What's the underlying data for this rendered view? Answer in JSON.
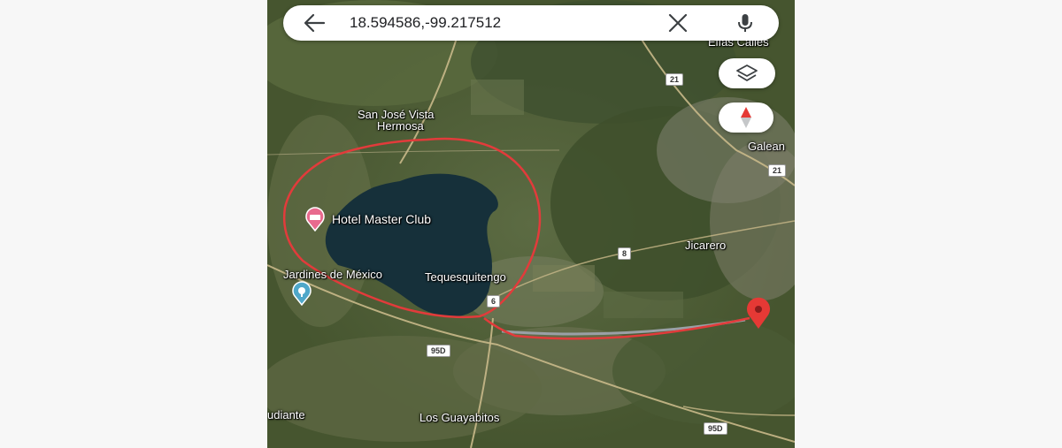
{
  "search": {
    "query": "18.594586,-99.217512",
    "back_icon": "arrow-left-icon",
    "clear_icon": "close-icon",
    "voice_icon": "microphone-icon"
  },
  "controls": {
    "layers_icon": "layers-icon",
    "compass_icon": "compass-icon"
  },
  "places": {
    "san_jose_line1": "San José Vista",
    "san_jose_line2": "Hermosa",
    "elias_calles": "Elías Calles",
    "galeana": "Galean",
    "hotel": "Hotel Master Club",
    "jardines": "Jardines de México",
    "tequesquitengo": "Tequesquitengo",
    "jicarero": "Jicarero",
    "estudiante": "udiante",
    "guayabitos": "Los Guayabitos"
  },
  "roads": {
    "r21_top": "21",
    "r21_right": "21",
    "r8": "8",
    "r6": "6",
    "r95d_left": "95D",
    "r95d_right": "95D"
  },
  "markers": {
    "hotel_icon": "hotel-pin-icon",
    "park_icon": "park-pin-icon",
    "destination_icon": "red-map-pin-icon"
  },
  "colors": {
    "annotation_red": "#e23b3b",
    "pin_red": "#e53935",
    "hotel_pin": "#e86a8e",
    "park_pin": "#4fa7c9",
    "lake": "#16303a",
    "route_line": "#9aa0a6"
  }
}
